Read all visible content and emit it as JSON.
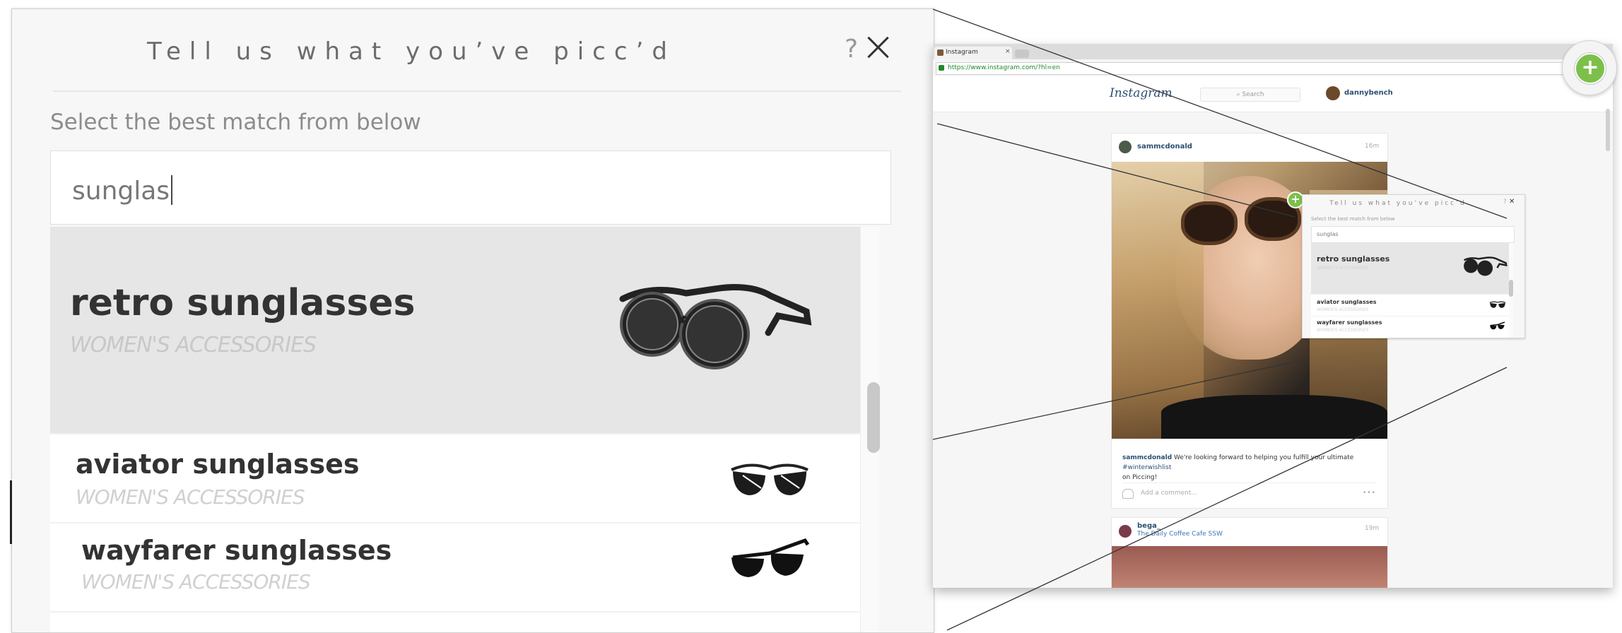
{
  "picker": {
    "title": "Tell us what you’ve picc’d",
    "help": "?",
    "prompt": "Select the best match from below",
    "search_value": "sunglas",
    "results": [
      {
        "name": "retro sunglasses",
        "category": "WOMEN'S ACCESSORIES",
        "icon": "retro-sunglasses-icon"
      },
      {
        "name": "aviator sunglasses",
        "category": "WOMEN'S ACCESSORIES",
        "icon": "aviator-sunglasses-icon"
      },
      {
        "name": "wayfarer sunglasses",
        "category": "WOMEN'S ACCESSORIES",
        "icon": "wayfarer-sunglasses-icon"
      }
    ],
    "accent_color": "#7cc04a"
  },
  "browser": {
    "tab_title": "Instagram",
    "tab_close": "×",
    "url": "https://www.instagram.com/?hl=en",
    "instagram": {
      "logo": "Instagram",
      "search_placeholder": "Search",
      "current_user": "dannybench",
      "post": {
        "username": "sammcdonald",
        "time": "16m",
        "caption_user": "sammcdonald",
        "caption_text": "We're looking forward to helping you fulfill your ultimate",
        "caption_hashtag": "#winterwishlist",
        "caption_tail": "on Piccing!",
        "comment_placeholder": "Add a comment...",
        "more": "•••"
      },
      "post2": {
        "username": "bega_",
        "location": "The Daily Coffee Cafe SSW",
        "time": "19m"
      }
    }
  },
  "extension": {
    "icon": "plus-icon",
    "label": "+"
  }
}
